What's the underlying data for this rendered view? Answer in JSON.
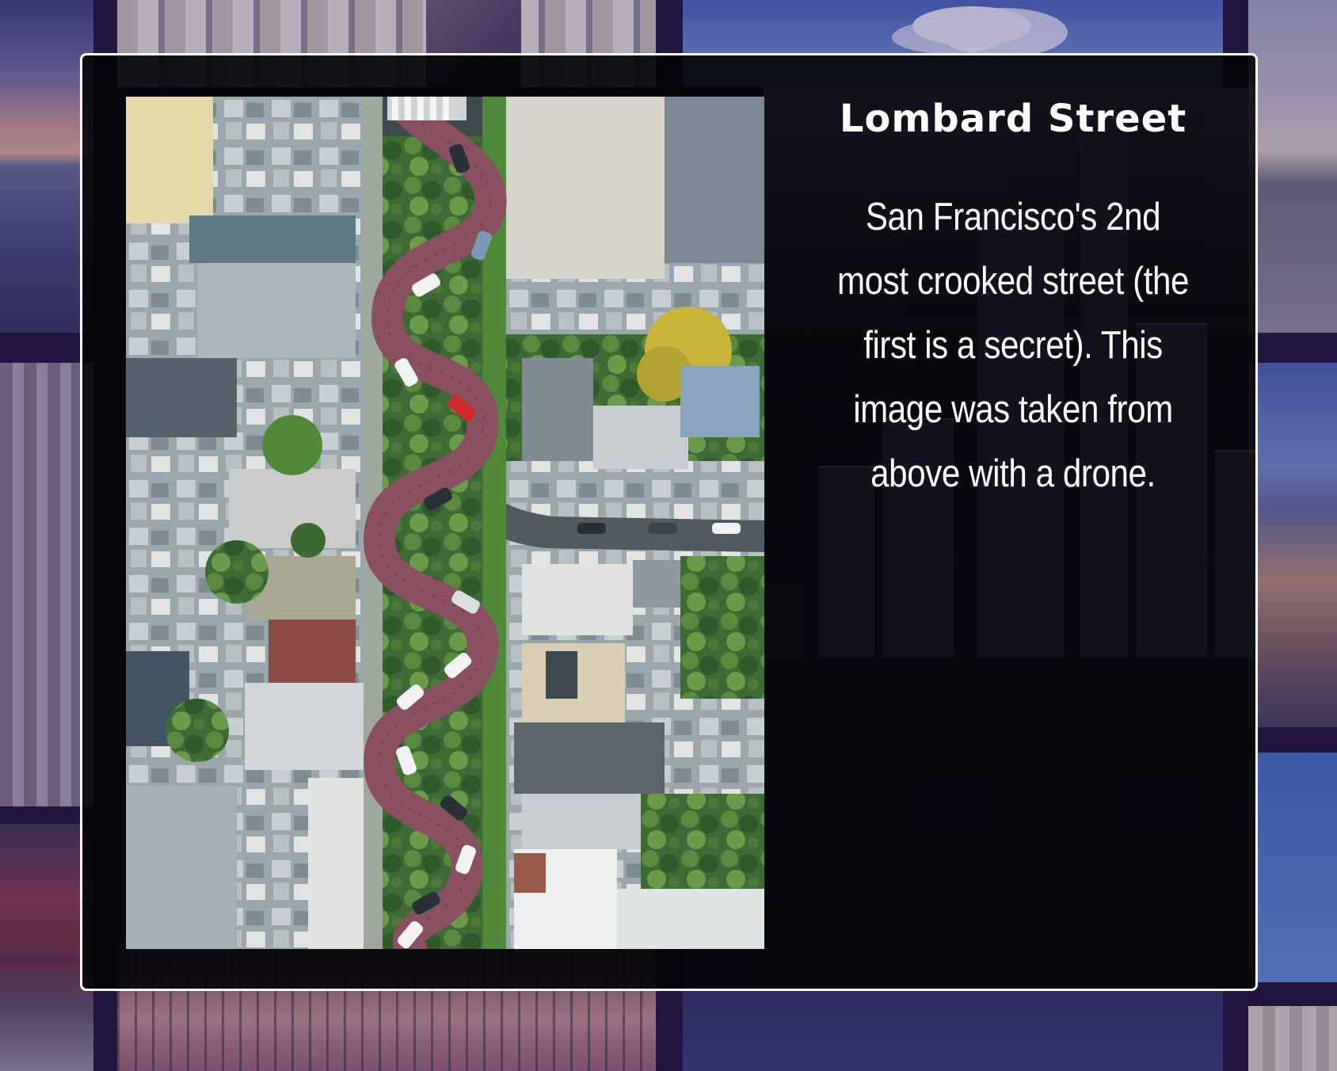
{
  "modal": {
    "title": "Lombard Street",
    "description": "San Francisco's 2nd most crooked street (the first is a secret). This image was taken from above with a drone."
  },
  "colors": {
    "modal_border": "#ffffff",
    "modal_background": "#040408",
    "page_background": "#22153f",
    "street_brick": "#8a5060",
    "title_text": "#ffffff"
  },
  "images": {
    "main_photo": "aerial drone view of winding brick road lined with houses and trees",
    "background_collage": "grid of San Francisco photo tiles"
  }
}
